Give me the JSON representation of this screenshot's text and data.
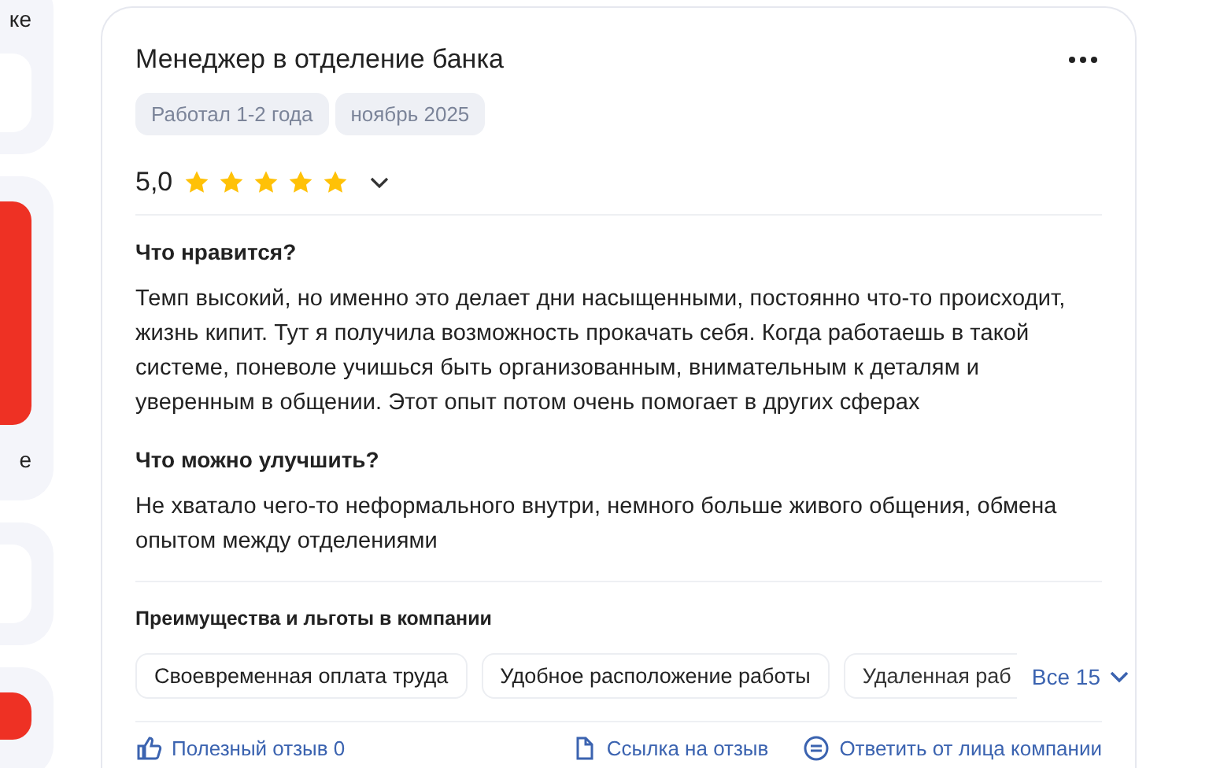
{
  "side_cards": [
    {
      "kind": "text",
      "text": "ке"
    },
    {
      "kind": "white"
    },
    {
      "kind": "red"
    },
    {
      "kind": "text",
      "text": "е"
    },
    {
      "kind": "white"
    },
    {
      "kind": "red"
    }
  ],
  "review": {
    "title": "Менеджер в отделение банка",
    "tags": [
      "Работал 1-2 года",
      "ноябрь 2025"
    ],
    "rating": "5,0",
    "stars": 5,
    "sections": [
      {
        "heading": "Что нравится?",
        "text": "Темп высокий, но именно это делает дни насыщенными, постоянно что-то происходит, жизнь кипит. Тут я получила возможность прокачать себя. Когда работаешь в такой системе, поневоле учишься быть организованным, внимательным к деталям и уверенным в общении. Этот опыт потом очень помогает в других сферах"
      },
      {
        "heading": "Что можно улучшить?",
        "text": "Не хватало чего-то неформального внутри, немного больше живого общения, обмена опытом между отделениями"
      }
    ],
    "benefits": {
      "title": "Преимущества и льготы в компании",
      "items": [
        "Своевременная оплата труда",
        "Удобное расположение работы",
        "Удаленная раб"
      ],
      "more": "Все 15"
    },
    "actions": [
      {
        "kind": "like",
        "label": "Полезный отзыв 0"
      },
      {
        "kind": "link",
        "label": "Ссылка на отзыв"
      },
      {
        "kind": "reply",
        "label": "Ответить от лица компании"
      }
    ]
  }
}
